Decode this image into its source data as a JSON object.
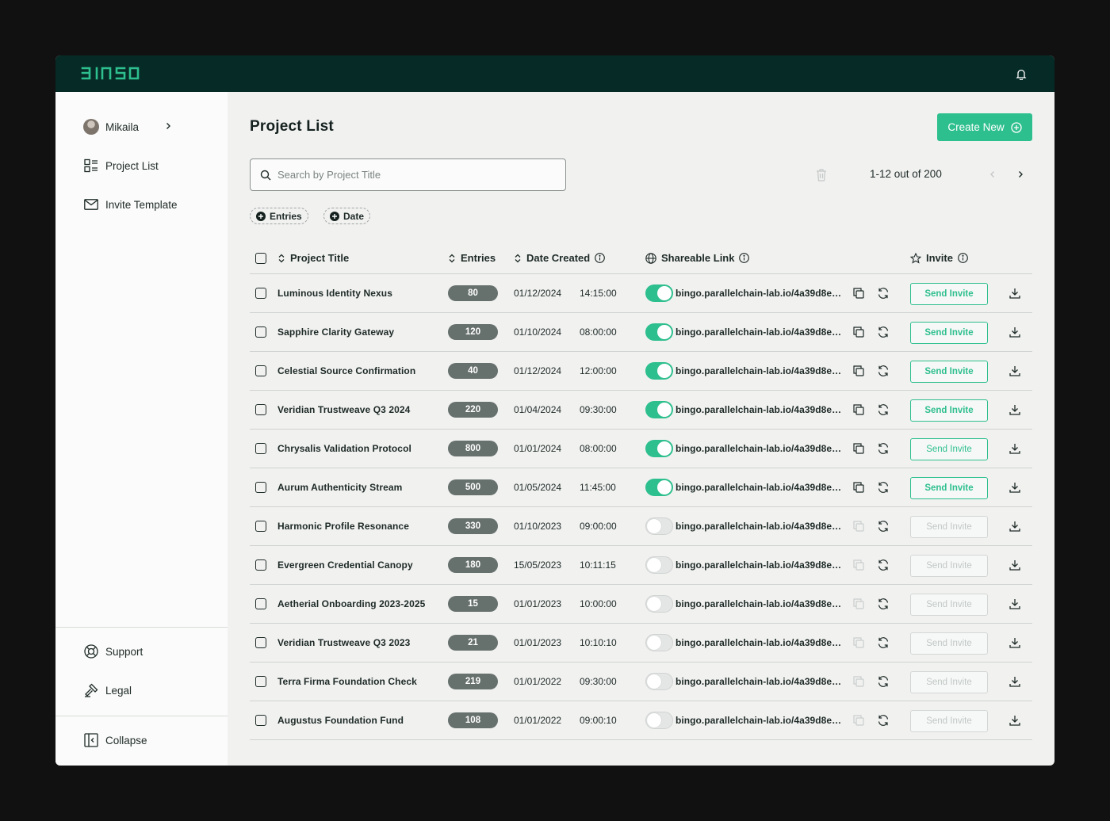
{
  "brand": {
    "logo_text": "BINGO",
    "accent": "#2ebf8e",
    "topbar_color": "#062b27"
  },
  "sidebar": {
    "user_name": "Mikaila",
    "items": [
      {
        "label": "Project List",
        "icon": "list-icon"
      },
      {
        "label": "Invite Template",
        "icon": "mail-icon"
      }
    ],
    "bottom_items": [
      {
        "label": "Support",
        "icon": "lifebuoy-icon"
      },
      {
        "label": "Legal",
        "icon": "gavel-icon"
      }
    ],
    "collapse_label": "Collapse"
  },
  "main": {
    "title": "Project List",
    "create_label": "Create New",
    "search_placeholder": "Search by Project Title",
    "pagination": "1-12 out of 200",
    "filters": [
      "Entries",
      "Date"
    ]
  },
  "table": {
    "headers": {
      "title": "Project Title",
      "entries": "Entries",
      "date": "Date Created",
      "link": "Shareable Link",
      "invite": "Invite"
    },
    "send_label": "Send Invite",
    "rows": [
      {
        "title": "Luminous Identity Nexus",
        "entries": "80",
        "date": "01/12/2024",
        "time": "14:15:00",
        "enabled": true,
        "link": "bingo.parallelchain-lab.io/4a39d8e6a...",
        "invite": "active"
      },
      {
        "title": "Sapphire Clarity Gateway",
        "entries": "120",
        "date": "01/10/2024",
        "time": "08:00:00",
        "enabled": true,
        "link": "bingo.parallelchain-lab.io/4a39d8e6a...",
        "invite": "active"
      },
      {
        "title": "Celestial Source Confirmation",
        "entries": "40",
        "date": "01/12/2024",
        "time": "12:00:00",
        "enabled": true,
        "link": "bingo.parallelchain-lab.io/4a39d8e6a...",
        "invite": "active"
      },
      {
        "title": "Veridian Trustweave Q3 2024",
        "entries": "220",
        "date": "01/04/2024",
        "time": "09:30:00",
        "enabled": true,
        "link": "bingo.parallelchain-lab.io/4a39d8e6a...",
        "invite": "active"
      },
      {
        "title": "Chrysalis Validation Protocol",
        "entries": "800",
        "date": "01/01/2024",
        "time": "08:00:00",
        "enabled": true,
        "link": "bingo.parallelchain-lab.io/4a39d8e6a...",
        "invite": "light"
      },
      {
        "title": "Aurum Authenticity Stream",
        "entries": "500",
        "date": "01/05/2024",
        "time": "11:45:00",
        "enabled": true,
        "link": "bingo.parallelchain-lab.io/4a39d8e6a...",
        "invite": "active"
      },
      {
        "title": "Harmonic Profile Resonance",
        "entries": "330",
        "date": "01/10/2023",
        "time": "09:00:00",
        "enabled": false,
        "link": "bingo.parallelchain-lab.io/4a39d8e6a...",
        "invite": "disabled"
      },
      {
        "title": "Evergreen Credential Canopy",
        "entries": "180",
        "date": "15/05/2023",
        "time": "10:11:15",
        "enabled": false,
        "link": "bingo.parallelchain-lab.io/4a39d8e6a...",
        "invite": "disabled"
      },
      {
        "title": "Aetherial Onboarding 2023-2025",
        "entries": "15",
        "date": "01/01/2023",
        "time": "10:00:00",
        "enabled": false,
        "link": "bingo.parallelchain-lab.io/4a39d8e6a...",
        "invite": "disabled"
      },
      {
        "title": "Veridian Trustweave Q3 2023",
        "entries": "21",
        "date": "01/01/2023",
        "time": "10:10:10",
        "enabled": false,
        "link": "bingo.parallelchain-lab.io/4a39d8e6a...",
        "invite": "disabled"
      },
      {
        "title": "Terra Firma Foundation Check",
        "entries": "219",
        "date": "01/01/2022",
        "time": "09:30:00",
        "enabled": false,
        "link": "bingo.parallelchain-lab.io/4a39d8e6a...",
        "invite": "disabled"
      },
      {
        "title": "Augustus Foundation Fund",
        "entries": "108",
        "date": "01/01/2022",
        "time": "09:00:10",
        "enabled": false,
        "link": "bingo.parallelchain-lab.io/4a39d8e6a...",
        "invite": "disabled"
      }
    ]
  }
}
